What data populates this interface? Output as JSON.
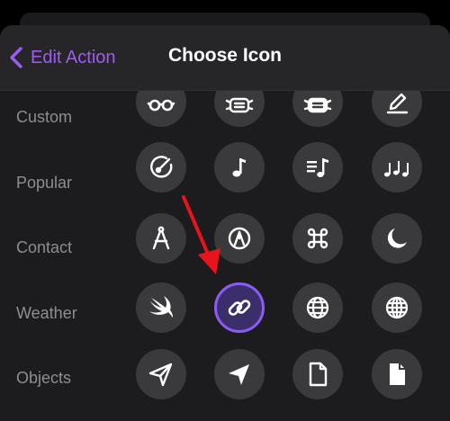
{
  "header": {
    "back_label": "Edit Action",
    "title": "Choose Icon"
  },
  "categories": [
    "Custom",
    "Popular",
    "Contact",
    "Weather",
    "Objects"
  ],
  "colors": {
    "accent": "#9f5cf3",
    "selected_ring": "#8a5cf3",
    "selected_fill": "#3b2f6b",
    "icon_background": "#3a3a3c",
    "annotation_arrow": "#e8131b"
  },
  "icon_grid": {
    "selected_icon": "link-icon",
    "rows": [
      [
        "glasses-icon",
        "mask-icon",
        "mask-filled-icon",
        "pencil-line-icon"
      ],
      [
        "gauge-icon",
        "music-note-icon",
        "music-list-icon",
        "music-notes-icon"
      ],
      [
        "compass-drafting-icon",
        "pen-nib-icon",
        "command-key-icon",
        "moon-icon"
      ],
      [
        "swift-icon",
        "link-icon",
        "globe-icon",
        "globe-alt-icon"
      ],
      [
        "paper-plane-icon",
        "paper-plane-filled-icon",
        "document-icon",
        "document-filled-icon"
      ]
    ]
  }
}
